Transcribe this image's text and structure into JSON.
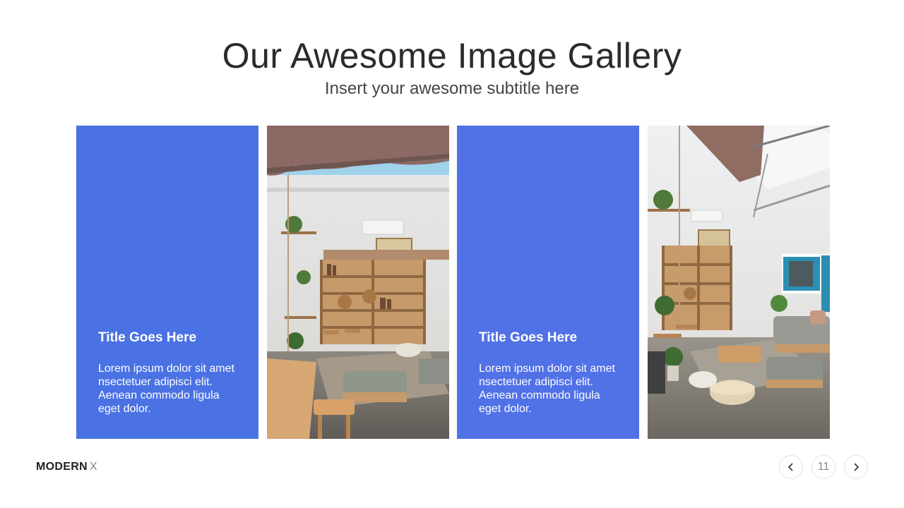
{
  "slide": {
    "title": "Our Awesome Image Gallery",
    "subtitle": "Insert your awesome subtitle here"
  },
  "cards": [
    {
      "title": "Title Goes Here",
      "text": "Lorem ipsum dolor sit amet nsectetuer adipisci elit. Aenean commodo ligula eget dolor.",
      "color": "#4a72e4"
    },
    {
      "title": "Title Goes Here",
      "text": "Lorem ipsum dolor sit amet nsectetuer adipisci elit. Aenean commodo ligula eget dolor.",
      "color": "#5171e6"
    }
  ],
  "footer": {
    "brand_strong": "MODERN",
    "brand_light": "X",
    "page_number": "11",
    "prev_icon": "chevron-left-icon",
    "next_icon": "chevron-right-icon"
  }
}
